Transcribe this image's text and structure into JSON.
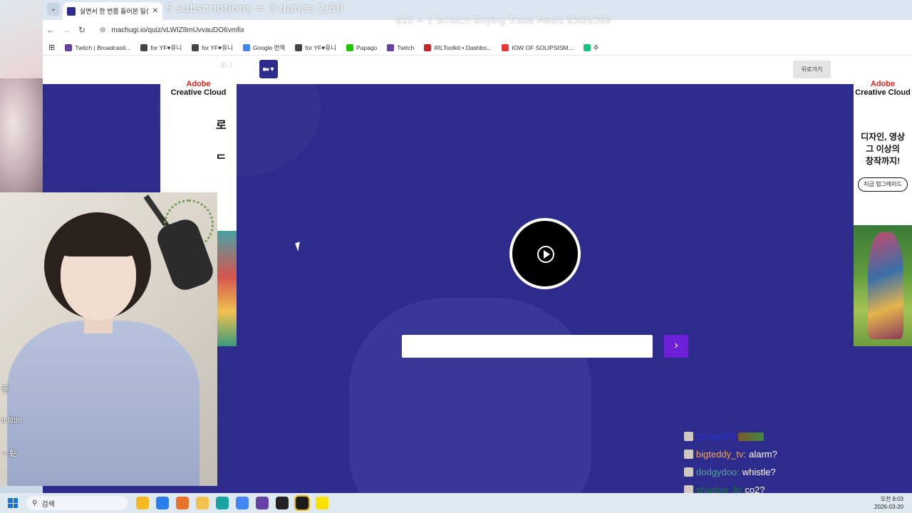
{
  "overlay": {
    "subscriptions": "5 subscriptions = 3 dance 2/50",
    "price": "$10 = 1 Scratch Buying Trade Meals $30/$369"
  },
  "browser": {
    "tab_title": "살면서 한 번쯤 들어본 일상 소",
    "tab_close": "✕",
    "url": "machugi.io/quiz/vLWIZ8mUvvauDO6vmfix",
    "bookmarks": [
      {
        "label": "Twitch | Broadcasti...",
        "color": "#6441a5"
      },
      {
        "label": "for YF♥유니",
        "color": "#444444"
      },
      {
        "label": "for YF♥유니",
        "color": "#444444"
      },
      {
        "label": "Google 번역",
        "color": "#4285f4"
      },
      {
        "label": "for YF♥유니",
        "color": "#444444"
      },
      {
        "label": "Papago",
        "color": "#1ec800"
      },
      {
        "label": "Twitch",
        "color": "#6441a5"
      },
      {
        "label": "IRLToolkit • Dashbo...",
        "color": "#c62828"
      },
      {
        "label": "IOW OF SOLIPSISM...",
        "color": "#e53935"
      },
      {
        "label": "주",
        "color": "#19c37d"
      }
    ]
  },
  "site": {
    "logo_text": "■●▼",
    "back_label": "뒤로가기"
  },
  "quiz": {
    "answer_value": "",
    "submit_label": "›"
  },
  "ads": {
    "brand_line1": "Adobe",
    "brand_line2": "Creative Cloud",
    "left_char": "로",
    "left_char2": "ᄃ",
    "right_line1": "디자인, 영상",
    "right_line2": "그 이상의",
    "right_line3": "창작까지!",
    "right_button": "지금 업그레이드",
    "info": "ⓘ ⋮"
  },
  "side_text": {
    "line1": "좋",
    "line2": "a little",
    "line3": "一點"
  },
  "chat": [
    {
      "user": "Zonta665",
      "user_color": "#2a35d6",
      "msg": "",
      "emote": true
    },
    {
      "user": "bigteddy_tv:",
      "user_color": "#f2a65a",
      "msg": "alarm?",
      "emote": false
    },
    {
      "user": "dodgydoo:",
      "user_color": "#5aa0a0",
      "msg": "whistle?",
      "emote": false
    },
    {
      "user": "shadow_llc",
      "user_color": "#1f7a3a",
      "msg": "co2?",
      "emote": false
    }
  ],
  "taskbar": {
    "search_placeholder": "검색",
    "time": "오전 8:03",
    "date": "2026-03-20",
    "icons": [
      {
        "name": "widgets-icon",
        "color": "#f5b81f"
      },
      {
        "name": "copilot-icon",
        "color": "#2b7de9"
      },
      {
        "name": "search-app-icon",
        "color": "#e8742a"
      },
      {
        "name": "file-explorer-icon",
        "color": "#f2c14e"
      },
      {
        "name": "edge-icon",
        "color": "#1aa3a3"
      },
      {
        "name": "chrome-icon",
        "color": "#4285f4"
      },
      {
        "name": "twitch-icon",
        "color": "#6441a5"
      },
      {
        "name": "obs-icon",
        "color": "#222222"
      },
      {
        "name": "app-icon",
        "color": "#1b1b1b"
      },
      {
        "name": "kakaotalk-icon",
        "color": "#fae100"
      }
    ]
  }
}
